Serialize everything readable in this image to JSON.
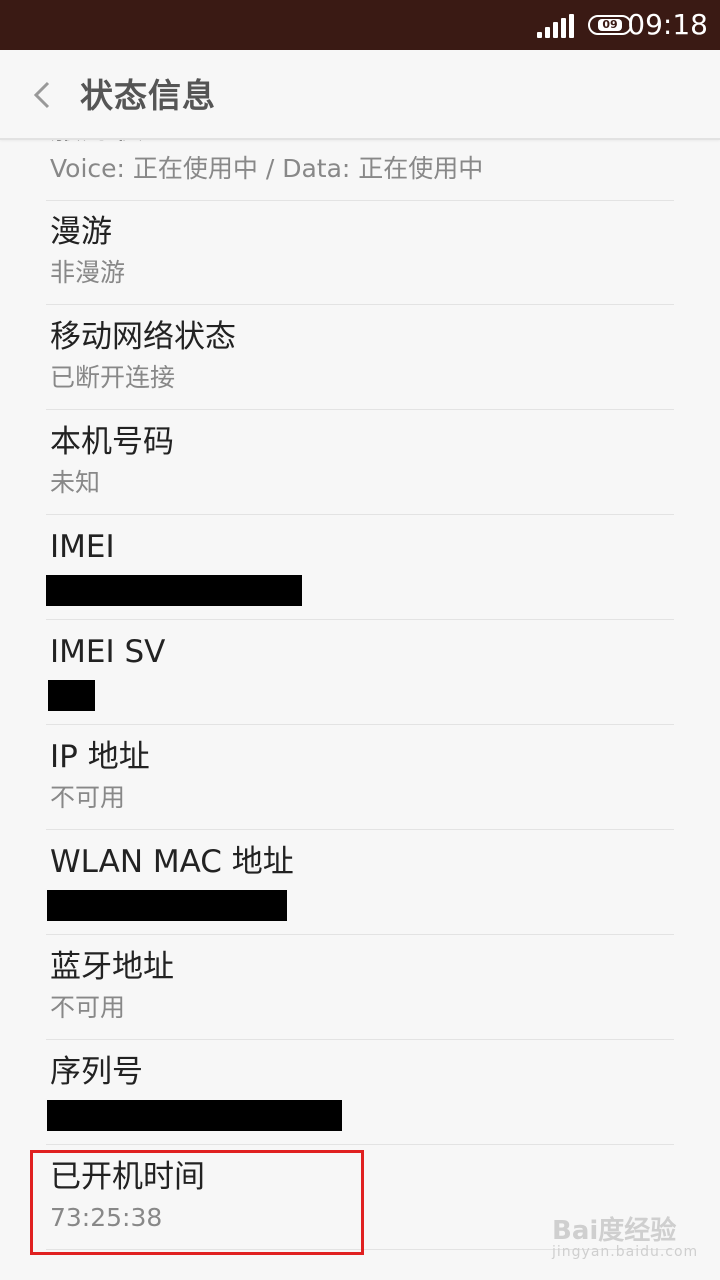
{
  "status_bar": {
    "time": "09:18",
    "battery_level": "09"
  },
  "header": {
    "title": "状态信息"
  },
  "items": [
    {
      "title": "服务状态",
      "value": "Voice: 正在使用中 / Data: 正在使用中"
    },
    {
      "title": "漫游",
      "value": "非漫游"
    },
    {
      "title": "移动网络状态",
      "value": "已断开连接"
    },
    {
      "title": "本机号码",
      "value": "未知"
    },
    {
      "title": "IMEI",
      "value": ""
    },
    {
      "title": "IMEI SV",
      "value": ""
    },
    {
      "title": "IP 地址",
      "value": "不可用"
    },
    {
      "title": "WLAN MAC 地址",
      "value": ""
    },
    {
      "title": "蓝牙地址",
      "value": "不可用"
    },
    {
      "title": "序列号",
      "value": ""
    },
    {
      "title": "已开机时间",
      "value": "73:25:38"
    }
  ],
  "watermark": {
    "text": "Bai度经验",
    "sub": "jingyan.baidu.com"
  },
  "colors": {
    "status_bar": "#3a1a14",
    "highlight": "#e02020"
  }
}
